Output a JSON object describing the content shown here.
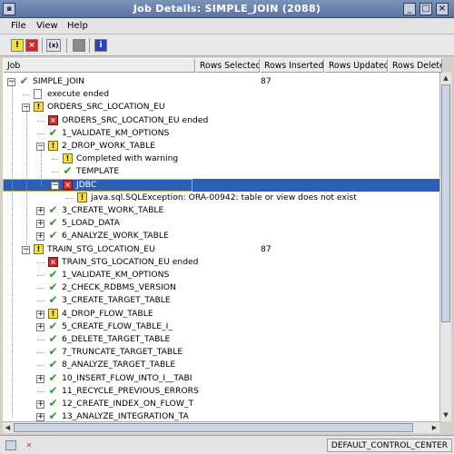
{
  "window": {
    "title": "Job Details: SIMPLE_JOIN (2088)"
  },
  "menu": [
    "File",
    "View",
    "Help"
  ],
  "toolbar": [
    "warnings-filter-icon",
    "errors-filter-icon",
    "variables-icon",
    "stop-icon",
    "info-icon"
  ],
  "columns": [
    "Job",
    "Rows Selected",
    "Rows Inserted",
    "Rows Updated",
    "Rows Deleted"
  ],
  "rows": [
    {
      "label": "SIMPLE_JOIN",
      "icon": "check",
      "exp": "-",
      "rows_inserted": "87"
    },
    {
      "label": "execute ended",
      "icon": "doc",
      "exp": ""
    },
    {
      "label": "ORDERS_SRC_LOCATION_EU",
      "icon": "warn",
      "exp": "-"
    },
    {
      "label": "ORDERS_SRC_LOCATION_EU ended",
      "icon": "err",
      "exp": ""
    },
    {
      "label": "1_VALIDATE_KM_OPTIONS",
      "icon": "check",
      "exp": ""
    },
    {
      "label": "2_DROP_WORK_TABLE",
      "icon": "warn",
      "exp": "-"
    },
    {
      "label": "Completed with warning",
      "icon": "warn",
      "exp": ""
    },
    {
      "label": "TEMPLATE",
      "icon": "check",
      "exp": ""
    },
    {
      "label": "JDBC",
      "icon": "err",
      "exp": "-",
      "selected": true
    },
    {
      "label": "java.sql.SQLException: ORA-00942: table or view does not exist",
      "icon": "warn",
      "exp": ""
    },
    {
      "label": "3_CREATE_WORK_TABLE",
      "icon": "check",
      "exp": "+"
    },
    {
      "label": "5_LOAD_DATA",
      "icon": "check",
      "exp": "+"
    },
    {
      "label": "6_ANALYZE_WORK_TABLE",
      "icon": "check",
      "exp": "+"
    },
    {
      "label": "TRAIN_STG_LOCATION_EU",
      "icon": "warn",
      "exp": "-",
      "rows_inserted": "87"
    },
    {
      "label": "TRAIN_STG_LOCATION_EU ended",
      "icon": "err",
      "exp": ""
    },
    {
      "label": "1_VALIDATE_KM_OPTIONS",
      "icon": "check",
      "exp": ""
    },
    {
      "label": "2_CHECK_RDBMS_VERSION",
      "icon": "check",
      "exp": ""
    },
    {
      "label": "3_CREATE_TARGET_TABLE",
      "icon": "check",
      "exp": ""
    },
    {
      "label": "4_DROP_FLOW_TABLE",
      "icon": "warn",
      "exp": "+"
    },
    {
      "label": "5_CREATE_FLOW_TABLE_I_",
      "icon": "check",
      "exp": "+"
    },
    {
      "label": "6_DELETE_TARGET_TABLE",
      "icon": "check",
      "exp": ""
    },
    {
      "label": "7_TRUNCATE_TARGET_TABLE",
      "icon": "check",
      "exp": ""
    },
    {
      "label": "8_ANALYZE_TARGET_TABLE",
      "icon": "check",
      "exp": ""
    },
    {
      "label": "10_INSERT_FLOW_INTO_I__TABI",
      "icon": "check",
      "exp": "+"
    },
    {
      "label": "11_RECYCLE_PREVIOUS_ERRORS",
      "icon": "check",
      "exp": ""
    },
    {
      "label": "12_CREATE_INDEX_ON_FLOW_T",
      "icon": "check",
      "exp": "+"
    },
    {
      "label": "13_ANALYZE_INTEGRATION_TA",
      "icon": "check",
      "exp": "+"
    }
  ],
  "status": {
    "context": "DEFAULT_CONTROL_CENTER"
  }
}
